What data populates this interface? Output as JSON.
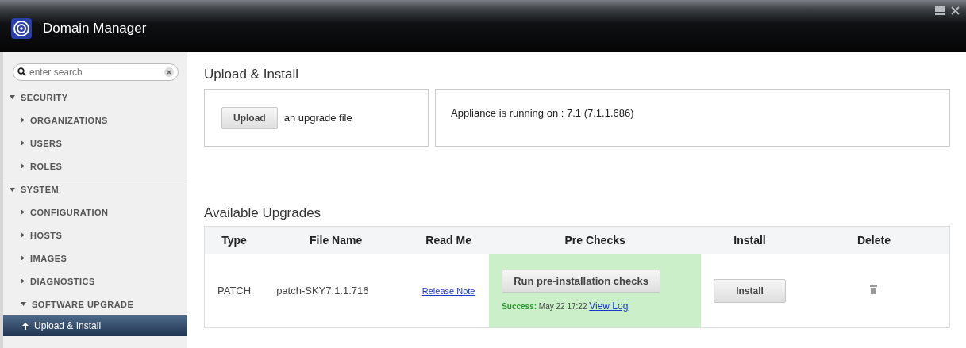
{
  "window": {
    "title": "Domain Manager"
  },
  "sidebar": {
    "search": {
      "placeholder": "enter search"
    },
    "items": [
      {
        "label": "SECURITY",
        "expanded": true,
        "selected": false,
        "children": [
          {
            "label": "ORGANIZATIONS",
            "expanded": false,
            "selected": false
          },
          {
            "label": "USERS",
            "expanded": false,
            "selected": false
          },
          {
            "label": "ROLES",
            "expanded": false,
            "selected": false
          }
        ]
      },
      {
        "label": "SYSTEM",
        "expanded": true,
        "selected": false,
        "children": [
          {
            "label": "CONFIGURATION",
            "expanded": false,
            "selected": false
          },
          {
            "label": "HOSTS",
            "expanded": false,
            "selected": false
          },
          {
            "label": "IMAGES",
            "expanded": false,
            "selected": false
          },
          {
            "label": "DIAGNOSTICS",
            "expanded": false,
            "selected": false
          },
          {
            "label": "SOFTWARE UPGRADE",
            "expanded": true,
            "selected": false,
            "children": [
              {
                "label": "Upload & Install",
                "selected": true
              }
            ]
          }
        ]
      }
    ]
  },
  "upload": {
    "heading": "Upload & Install",
    "button": "Upload",
    "caption": "an upgrade file",
    "status": "Appliance is running on : 7.1 (7.1.1.686)"
  },
  "upgrades": {
    "heading": "Available Upgrades",
    "columns": [
      "Type",
      "File Name",
      "Read Me",
      "Pre Checks",
      "Install",
      "Delete"
    ],
    "rows": [
      {
        "type": "PATCH",
        "file_name": "patch-SKY7.1.1.716",
        "read_me": "Release Note",
        "precheck_button": "Run pre-installation checks",
        "precheck_label": "Success:",
        "precheck_time": "May 22 17:22",
        "precheck_link": "View Log",
        "passed": true,
        "install": "Install"
      }
    ]
  }
}
